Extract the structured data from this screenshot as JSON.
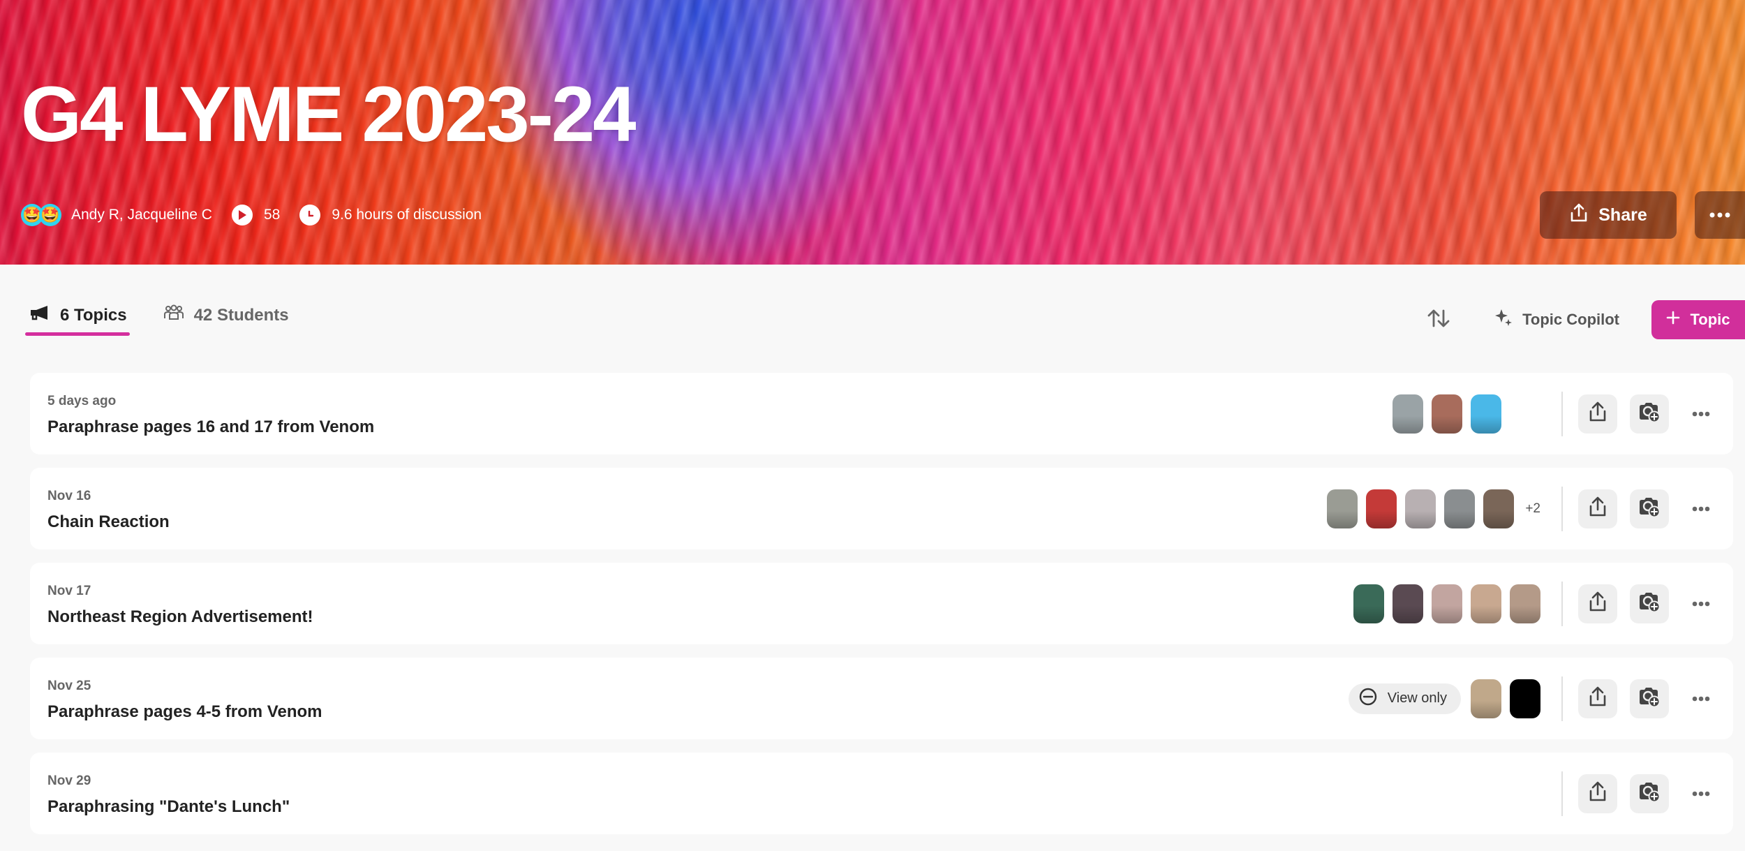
{
  "banner": {
    "title": "G4 LYME 2023-24",
    "owners_icon": "star-struck-emoji-avatar",
    "owners": "Andy R, Jacqueline C",
    "videos_icon": "play-icon",
    "videos_count": "58",
    "duration_icon": "clock-icon",
    "duration": "9.6 hours of discussion",
    "share_label": "Share",
    "share_icon": "share-icon",
    "more_icon": "more-horizontal-icon"
  },
  "tabs": [
    {
      "label": "6 Topics",
      "icon": "megaphone-icon",
      "active": true
    },
    {
      "label": "42 Students",
      "icon": "people-icon",
      "active": false
    }
  ],
  "toolbar": {
    "sort_icon": "sort-arrows-icon",
    "copilot_label": "Topic Copilot",
    "copilot_icon": "sparkle-icon",
    "add_topic_label": "Topic",
    "add_topic_icon": "plus-icon"
  },
  "colors": {
    "accent": "#d12f9b",
    "page_background": "#f8f8f8",
    "card_background": "#ffffff"
  },
  "topics": [
    {
      "date": "5 days ago",
      "title": "Paraphrase pages 16 and 17 from Venom",
      "view_only": false,
      "thumbnails": [
        "#9aa3a6",
        "#a86c5c",
        "#4ab8e8"
      ],
      "extra_count": ""
    },
    {
      "date": "Nov 16",
      "title": "Chain Reaction",
      "view_only": false,
      "thumbnails": [
        "#9a9c94",
        "#c43a38",
        "#b8b0b2",
        "#8a8e90",
        "#7a6658"
      ],
      "extra_count": "+2"
    },
    {
      "date": "Nov 17",
      "title": "Northeast Region Advertisement!",
      "view_only": false,
      "thumbnails": [
        "#3a6a58",
        "#5a4a52",
        "#c2a5a0",
        "#c8a890",
        "#b49a88"
      ],
      "extra_count": ""
    },
    {
      "date": "Nov 25",
      "title": "Paraphrase pages 4-5 from Venom",
      "view_only": true,
      "view_only_label": "View only",
      "thumbnails": [
        "#c0a88a",
        "#000000"
      ],
      "extra_count": ""
    },
    {
      "date": "Nov 29",
      "title": "Paraphrasing \"Dante's Lunch\"",
      "view_only": false,
      "thumbnails": [],
      "extra_count": ""
    }
  ]
}
